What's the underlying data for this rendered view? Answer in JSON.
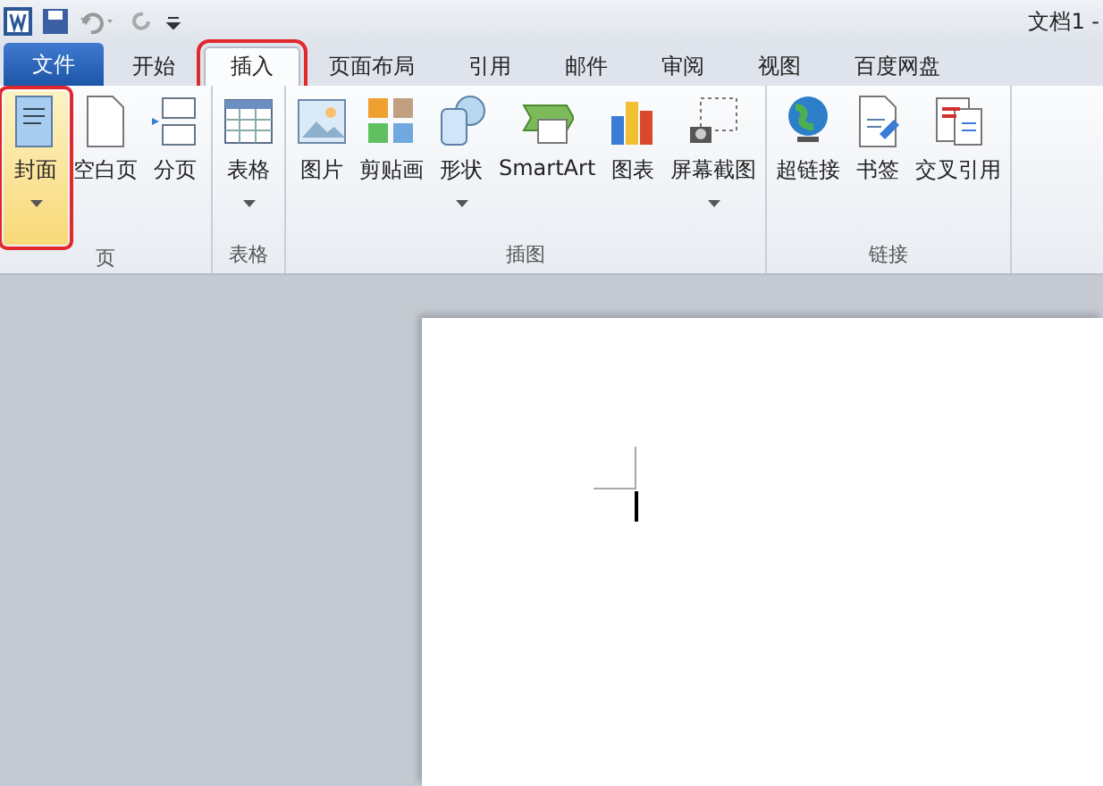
{
  "window": {
    "title": "文档1 -"
  },
  "tabs": [
    {
      "label": "文件",
      "kind": "file",
      "selected": false,
      "highlighted": false
    },
    {
      "label": "开始",
      "kind": "tab",
      "selected": false,
      "highlighted": false
    },
    {
      "label": "插入",
      "kind": "tab",
      "selected": true,
      "highlighted": true
    },
    {
      "label": "页面布局",
      "kind": "tab",
      "selected": false,
      "highlighted": false
    },
    {
      "label": "引用",
      "kind": "tab",
      "selected": false,
      "highlighted": false
    },
    {
      "label": "邮件",
      "kind": "tab",
      "selected": false,
      "highlighted": false
    },
    {
      "label": "审阅",
      "kind": "tab",
      "selected": false,
      "highlighted": false
    },
    {
      "label": "视图",
      "kind": "tab",
      "selected": false,
      "highlighted": false
    },
    {
      "label": "百度网盘",
      "kind": "tab",
      "selected": false,
      "highlighted": false
    }
  ],
  "groups": [
    {
      "label": "页",
      "buttons": [
        {
          "label": "封面",
          "dropdown": true,
          "highlighted": true
        },
        {
          "label": "空白页",
          "dropdown": false,
          "highlighted": false
        },
        {
          "label": "分页",
          "dropdown": false,
          "highlighted": false
        }
      ]
    },
    {
      "label": "表格",
      "buttons": [
        {
          "label": "表格",
          "dropdown": true,
          "highlighted": false
        }
      ]
    },
    {
      "label": "插图",
      "buttons": [
        {
          "label": "图片",
          "dropdown": false,
          "highlighted": false
        },
        {
          "label": "剪贴画",
          "dropdown": false,
          "highlighted": false
        },
        {
          "label": "形状",
          "dropdown": true,
          "highlighted": false
        },
        {
          "label": "SmartArt",
          "dropdown": false,
          "highlighted": false
        },
        {
          "label": "图表",
          "dropdown": false,
          "highlighted": false
        },
        {
          "label": "屏幕截图",
          "dropdown": true,
          "highlighted": false
        }
      ]
    },
    {
      "label": "链接",
      "buttons": [
        {
          "label": "超链接",
          "dropdown": false,
          "highlighted": false
        },
        {
          "label": "书签",
          "dropdown": false,
          "highlighted": false
        },
        {
          "label": "交叉引用",
          "dropdown": false,
          "highlighted": false
        }
      ]
    }
  ]
}
